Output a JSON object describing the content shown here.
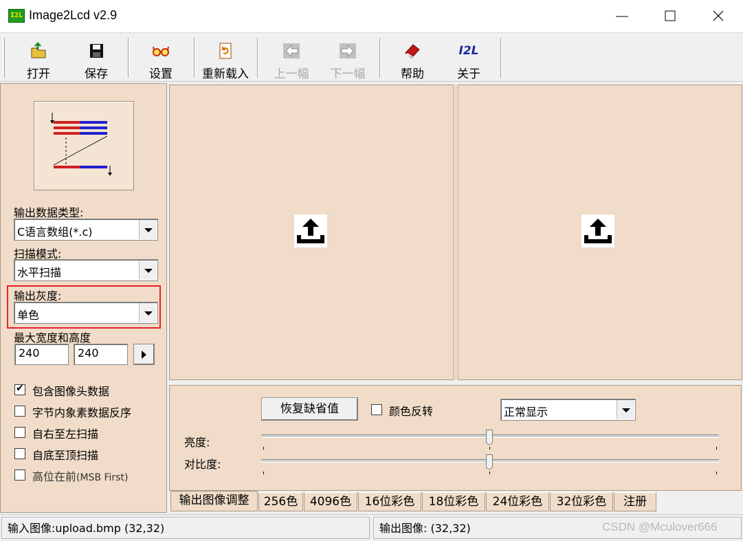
{
  "window": {
    "title": "Image2Lcd v2.9",
    "logo_text": "I2L"
  },
  "toolbar": {
    "open": "打开",
    "save": "保存",
    "settings": "设置",
    "reload": "重新载入",
    "prev": "上一幅",
    "next": "下一幅",
    "help": "帮助",
    "about": "关于",
    "about_logo": "I2L"
  },
  "left_panel": {
    "output_type_label": "输出数据类型:",
    "output_type_value": "C语言数组(*.c)",
    "scan_mode_label": "扫描模式:",
    "scan_mode_value": "水平扫描",
    "gray_label": "输出灰度:",
    "gray_value": "单色",
    "max_size_label": "最大宽度和高度",
    "max_width": "240",
    "max_height": "240",
    "options": [
      {
        "label": "包含图像头数据",
        "checked": true
      },
      {
        "label": "字节内象素数据反序",
        "checked": false
      },
      {
        "label": "自右至左扫描",
        "checked": false
      },
      {
        "label": "自底至顶扫描",
        "checked": false
      },
      {
        "label": "高位在前",
        "suffix": "(MSB First)",
        "checked": false
      }
    ]
  },
  "adjust": {
    "restore_defaults": "恢复缺省值",
    "invert_label": "颜色反转",
    "display_mode": "正常显示",
    "brightness_label": "亮度:",
    "contrast_label": "对比度:"
  },
  "tabs": [
    "输出图像调整",
    "256色",
    "4096色",
    "16位彩色",
    "18位彩色",
    "24位彩色",
    "32位彩色",
    "注册"
  ],
  "status": {
    "input": "输入图像:upload.bmp (32,32)",
    "output": "输出图像:  (32,32)"
  },
  "watermark": "CSDN @Mculover666",
  "colors": {
    "panel_bg": "#f0dcc8",
    "highlight": "#e8212a",
    "logo_green": "#1f9d1f"
  }
}
